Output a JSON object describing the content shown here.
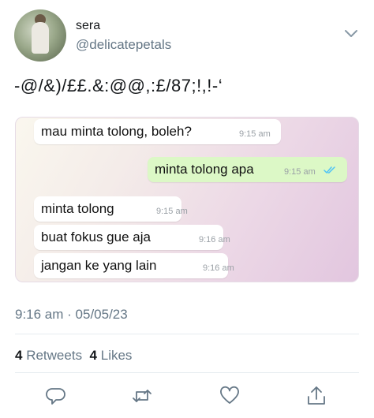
{
  "user": {
    "display_name": "sera",
    "handle": "@delicatepetals"
  },
  "tweet": {
    "text": "-@/&)/££.&:@@,:£/87;!,!-‘"
  },
  "chat": {
    "messages": [
      {
        "text": "mau minta tolong, boleh?",
        "time": "9:15 am",
        "direction": "incoming"
      },
      {
        "text": "minta tolong apa",
        "time": "9:15 am",
        "direction": "outgoing",
        "status": "read"
      },
      {
        "text": "minta tolong",
        "time": "9:15 am",
        "direction": "incoming"
      },
      {
        "text": "buat fokus gue aja",
        "time": "9:16 am",
        "direction": "incoming"
      },
      {
        "text": "jangan ke yang lain",
        "time": "9:16 am",
        "direction": "incoming"
      }
    ]
  },
  "meta": {
    "timestamp": "9:16 am · 05/05/23",
    "retweets_count": "4",
    "retweets_label": "Retweets",
    "likes_count": "4",
    "likes_label": "Likes"
  },
  "colors": {
    "secondary_text": "#657786",
    "outgoing_bubble": "#dcf8c6",
    "read_ticks": "#4fc3f7"
  },
  "icons": [
    "chevron-down-icon",
    "reply-icon",
    "retweet-icon",
    "like-icon",
    "share-icon",
    "double-check-icon"
  ]
}
